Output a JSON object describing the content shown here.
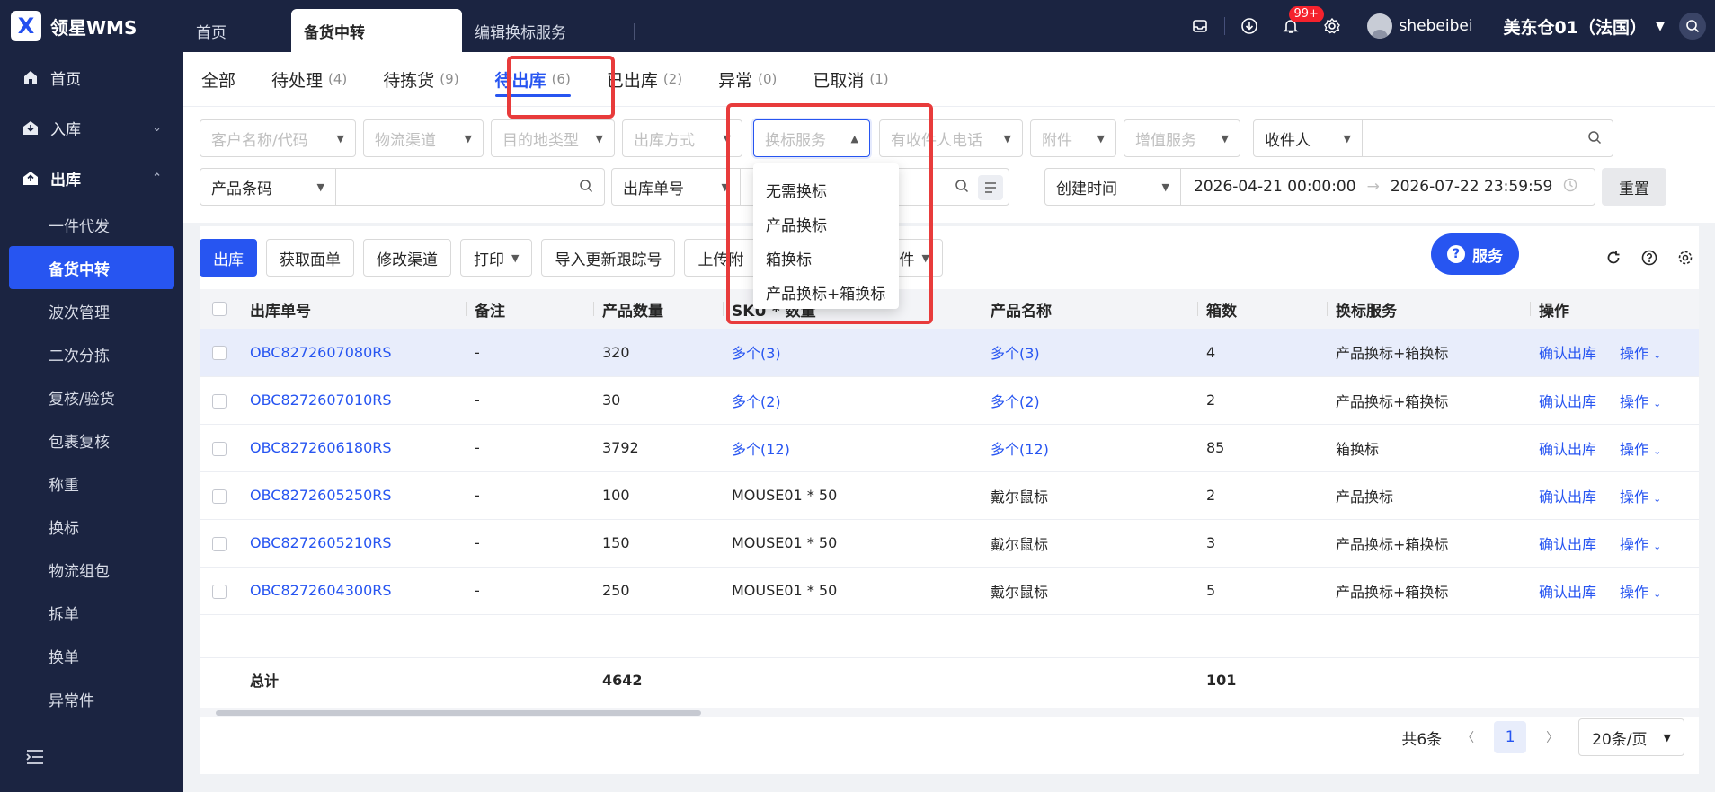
{
  "app": {
    "logo_text": "领星WMS",
    "logo_glyph": "X"
  },
  "top_tabs": [
    {
      "label": "首页"
    },
    {
      "label": "备货中转"
    },
    {
      "label": "编辑换标服务"
    }
  ],
  "header": {
    "notification_badge": "99+",
    "username": "shebeibei",
    "warehouse": "美东仓01（法国）"
  },
  "sidebar": {
    "home": "首页",
    "inbound": "入库",
    "outbound": "出库",
    "sub_items": [
      "一件代发",
      "备货中转",
      "波次管理",
      "二次分拣",
      "复核/验货",
      "包裹复核",
      "称重",
      "换标",
      "物流组包",
      "拆单",
      "换单",
      "异常件"
    ]
  },
  "status_tabs": [
    {
      "label": "全部",
      "count": ""
    },
    {
      "label": "待处理",
      "count": "(4)"
    },
    {
      "label": "待拣货",
      "count": "(9)"
    },
    {
      "label": "待出库",
      "count": "(6)"
    },
    {
      "label": "已出库",
      "count": "(2)"
    },
    {
      "label": "异常",
      "count": "(0)"
    },
    {
      "label": "已取消",
      "count": "(1)"
    }
  ],
  "filters": {
    "customer": "客户名称/代码",
    "channel": "物流渠道",
    "dest_type": "目的地类型",
    "out_method": "出库方式",
    "relabel_service": "换标服务",
    "receiver_phone": "有收件人电话",
    "attachment": "附件",
    "value_added": "增值服务",
    "receiver": "收件人",
    "product_barcode": "产品条码",
    "outbound_no": "出库单号",
    "created_time": "创建时间",
    "date_start": "2026-04-21 00:00:00",
    "date_end": "2026-07-22 23:59:59",
    "reset": "重置"
  },
  "dropdown_options": [
    "无需换标",
    "产品换标",
    "箱换标",
    "产品换标+箱换标"
  ],
  "toolbar": {
    "outbound": "出库",
    "get_label": "获取面单",
    "modify_channel": "修改渠道",
    "print": "打印",
    "import_tracking": "导入更新跟踪号",
    "upload_attach": "上传附",
    "export_attach": "出附件",
    "service": "服务"
  },
  "table": {
    "headers": [
      "出库单号",
      "备注",
      "产品数量",
      "SKU * 数量",
      "产品名称",
      "箱数",
      "换标服务",
      "操作"
    ],
    "rows": [
      {
        "order": "OBC8272607080RS",
        "note": "-",
        "qty": "320",
        "sku": "多个(3)",
        "name": "多个(3)",
        "boxes": "4",
        "service": "产品换标+箱换标",
        "confirm": "确认出库",
        "op": "操作"
      },
      {
        "order": "OBC8272607010RS",
        "note": "-",
        "qty": "30",
        "sku": "多个(2)",
        "name": "多个(2)",
        "boxes": "2",
        "service": "产品换标+箱换标",
        "confirm": "确认出库",
        "op": "操作"
      },
      {
        "order": "OBC8272606180RS",
        "note": "-",
        "qty": "3792",
        "sku": "多个(12)",
        "name": "多个(12)",
        "boxes": "85",
        "service": "箱换标",
        "confirm": "确认出库",
        "op": "操作"
      },
      {
        "order": "OBC8272605250RS",
        "note": "-",
        "qty": "100",
        "sku": "MOUSE01 * 50",
        "name": "戴尔鼠标",
        "boxes": "2",
        "service": "产品换标",
        "confirm": "确认出库",
        "op": "操作"
      },
      {
        "order": "OBC8272605210RS",
        "note": "-",
        "qty": "150",
        "sku": "MOUSE01 * 50",
        "name": "戴尔鼠标",
        "boxes": "3",
        "service": "产品换标+箱换标",
        "confirm": "确认出库",
        "op": "操作"
      },
      {
        "order": "OBC8272604300RS",
        "note": "-",
        "qty": "250",
        "sku": "MOUSE01 * 50",
        "name": "戴尔鼠标",
        "boxes": "5",
        "service": "产品换标+箱换标",
        "confirm": "确认出库",
        "op": "操作"
      }
    ],
    "total_label": "总计",
    "total_qty": "4642",
    "total_boxes": "101"
  },
  "pagination": {
    "total": "共6条",
    "page": "1",
    "page_size": "20条/页"
  },
  "colors": {
    "brand": "#2755f1",
    "nav_bg": "#1b2441",
    "highlight": "#e83b3b"
  }
}
